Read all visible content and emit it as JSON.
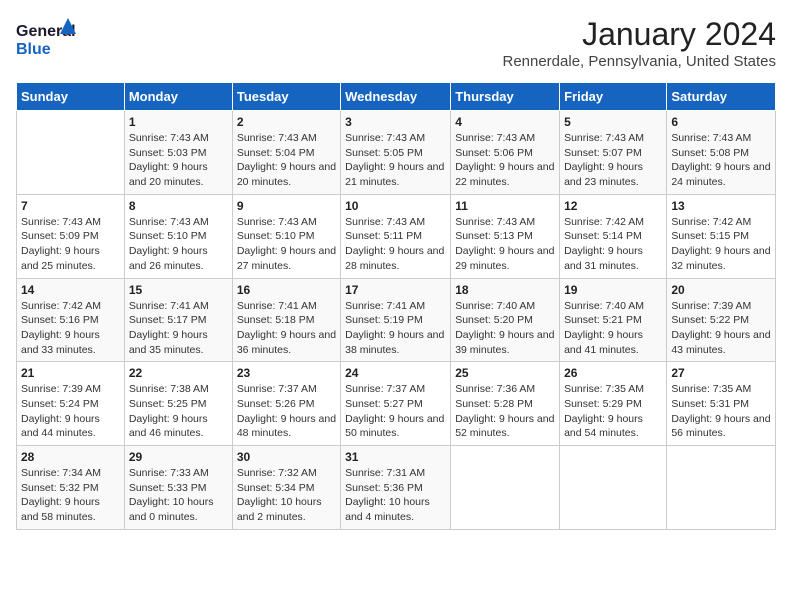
{
  "logo": {
    "line1": "General",
    "line2": "Blue"
  },
  "title": "January 2024",
  "subtitle": "Rennerdale, Pennsylvania, United States",
  "headers": [
    "Sunday",
    "Monday",
    "Tuesday",
    "Wednesday",
    "Thursday",
    "Friday",
    "Saturday"
  ],
  "weeks": [
    [
      {
        "day": "",
        "sunrise": "",
        "sunset": "",
        "daylight": ""
      },
      {
        "day": "1",
        "sunrise": "Sunrise: 7:43 AM",
        "sunset": "Sunset: 5:03 PM",
        "daylight": "Daylight: 9 hours and 20 minutes."
      },
      {
        "day": "2",
        "sunrise": "Sunrise: 7:43 AM",
        "sunset": "Sunset: 5:04 PM",
        "daylight": "Daylight: 9 hours and 20 minutes."
      },
      {
        "day": "3",
        "sunrise": "Sunrise: 7:43 AM",
        "sunset": "Sunset: 5:05 PM",
        "daylight": "Daylight: 9 hours and 21 minutes."
      },
      {
        "day": "4",
        "sunrise": "Sunrise: 7:43 AM",
        "sunset": "Sunset: 5:06 PM",
        "daylight": "Daylight: 9 hours and 22 minutes."
      },
      {
        "day": "5",
        "sunrise": "Sunrise: 7:43 AM",
        "sunset": "Sunset: 5:07 PM",
        "daylight": "Daylight: 9 hours and 23 minutes."
      },
      {
        "day": "6",
        "sunrise": "Sunrise: 7:43 AM",
        "sunset": "Sunset: 5:08 PM",
        "daylight": "Daylight: 9 hours and 24 minutes."
      }
    ],
    [
      {
        "day": "7",
        "sunrise": "Sunrise: 7:43 AM",
        "sunset": "Sunset: 5:09 PM",
        "daylight": "Daylight: 9 hours and 25 minutes."
      },
      {
        "day": "8",
        "sunrise": "Sunrise: 7:43 AM",
        "sunset": "Sunset: 5:10 PM",
        "daylight": "Daylight: 9 hours and 26 minutes."
      },
      {
        "day": "9",
        "sunrise": "Sunrise: 7:43 AM",
        "sunset": "Sunset: 5:10 PM",
        "daylight": "Daylight: 9 hours and 27 minutes."
      },
      {
        "day": "10",
        "sunrise": "Sunrise: 7:43 AM",
        "sunset": "Sunset: 5:11 PM",
        "daylight": "Daylight: 9 hours and 28 minutes."
      },
      {
        "day": "11",
        "sunrise": "Sunrise: 7:43 AM",
        "sunset": "Sunset: 5:13 PM",
        "daylight": "Daylight: 9 hours and 29 minutes."
      },
      {
        "day": "12",
        "sunrise": "Sunrise: 7:42 AM",
        "sunset": "Sunset: 5:14 PM",
        "daylight": "Daylight: 9 hours and 31 minutes."
      },
      {
        "day": "13",
        "sunrise": "Sunrise: 7:42 AM",
        "sunset": "Sunset: 5:15 PM",
        "daylight": "Daylight: 9 hours and 32 minutes."
      }
    ],
    [
      {
        "day": "14",
        "sunrise": "Sunrise: 7:42 AM",
        "sunset": "Sunset: 5:16 PM",
        "daylight": "Daylight: 9 hours and 33 minutes."
      },
      {
        "day": "15",
        "sunrise": "Sunrise: 7:41 AM",
        "sunset": "Sunset: 5:17 PM",
        "daylight": "Daylight: 9 hours and 35 minutes."
      },
      {
        "day": "16",
        "sunrise": "Sunrise: 7:41 AM",
        "sunset": "Sunset: 5:18 PM",
        "daylight": "Daylight: 9 hours and 36 minutes."
      },
      {
        "day": "17",
        "sunrise": "Sunrise: 7:41 AM",
        "sunset": "Sunset: 5:19 PM",
        "daylight": "Daylight: 9 hours and 38 minutes."
      },
      {
        "day": "18",
        "sunrise": "Sunrise: 7:40 AM",
        "sunset": "Sunset: 5:20 PM",
        "daylight": "Daylight: 9 hours and 39 minutes."
      },
      {
        "day": "19",
        "sunrise": "Sunrise: 7:40 AM",
        "sunset": "Sunset: 5:21 PM",
        "daylight": "Daylight: 9 hours and 41 minutes."
      },
      {
        "day": "20",
        "sunrise": "Sunrise: 7:39 AM",
        "sunset": "Sunset: 5:22 PM",
        "daylight": "Daylight: 9 hours and 43 minutes."
      }
    ],
    [
      {
        "day": "21",
        "sunrise": "Sunrise: 7:39 AM",
        "sunset": "Sunset: 5:24 PM",
        "daylight": "Daylight: 9 hours and 44 minutes."
      },
      {
        "day": "22",
        "sunrise": "Sunrise: 7:38 AM",
        "sunset": "Sunset: 5:25 PM",
        "daylight": "Daylight: 9 hours and 46 minutes."
      },
      {
        "day": "23",
        "sunrise": "Sunrise: 7:37 AM",
        "sunset": "Sunset: 5:26 PM",
        "daylight": "Daylight: 9 hours and 48 minutes."
      },
      {
        "day": "24",
        "sunrise": "Sunrise: 7:37 AM",
        "sunset": "Sunset: 5:27 PM",
        "daylight": "Daylight: 9 hours and 50 minutes."
      },
      {
        "day": "25",
        "sunrise": "Sunrise: 7:36 AM",
        "sunset": "Sunset: 5:28 PM",
        "daylight": "Daylight: 9 hours and 52 minutes."
      },
      {
        "day": "26",
        "sunrise": "Sunrise: 7:35 AM",
        "sunset": "Sunset: 5:29 PM",
        "daylight": "Daylight: 9 hours and 54 minutes."
      },
      {
        "day": "27",
        "sunrise": "Sunrise: 7:35 AM",
        "sunset": "Sunset: 5:31 PM",
        "daylight": "Daylight: 9 hours and 56 minutes."
      }
    ],
    [
      {
        "day": "28",
        "sunrise": "Sunrise: 7:34 AM",
        "sunset": "Sunset: 5:32 PM",
        "daylight": "Daylight: 9 hours and 58 minutes."
      },
      {
        "day": "29",
        "sunrise": "Sunrise: 7:33 AM",
        "sunset": "Sunset: 5:33 PM",
        "daylight": "Daylight: 10 hours and 0 minutes."
      },
      {
        "day": "30",
        "sunrise": "Sunrise: 7:32 AM",
        "sunset": "Sunset: 5:34 PM",
        "daylight": "Daylight: 10 hours and 2 minutes."
      },
      {
        "day": "31",
        "sunrise": "Sunrise: 7:31 AM",
        "sunset": "Sunset: 5:36 PM",
        "daylight": "Daylight: 10 hours and 4 minutes."
      },
      {
        "day": "",
        "sunrise": "",
        "sunset": "",
        "daylight": ""
      },
      {
        "day": "",
        "sunrise": "",
        "sunset": "",
        "daylight": ""
      },
      {
        "day": "",
        "sunrise": "",
        "sunset": "",
        "daylight": ""
      }
    ]
  ]
}
